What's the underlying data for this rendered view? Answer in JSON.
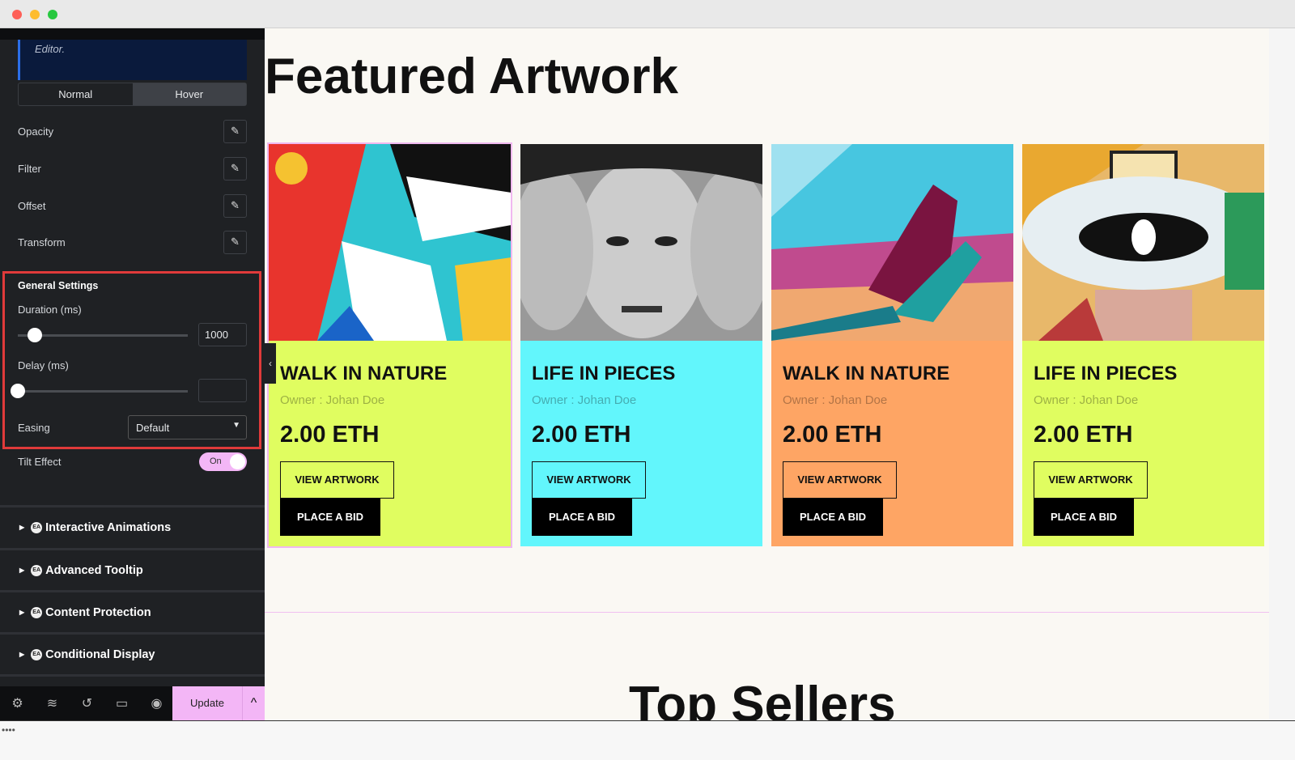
{
  "sidebar": {
    "notice": "Editor.",
    "tabs": [
      "Normal",
      "Hover"
    ],
    "rows": [
      "Opacity",
      "Filter",
      "Offset",
      "Transform"
    ],
    "general_settings": "General Settings",
    "duration_label": "Duration (ms)",
    "duration_value": "1000",
    "delay_label": "Delay (ms)",
    "delay_value": "",
    "easing_label": "Easing",
    "easing_value": "Default",
    "tilt_label": "Tilt Effect",
    "tilt_value": "On",
    "sections": [
      "Interactive Animations",
      "Advanced Tooltip",
      "Content Protection",
      "Conditional Display"
    ],
    "update": "Update"
  },
  "canvas": {
    "heading": "Featured Artwork",
    "cards": [
      {
        "title": "WALK IN NATURE",
        "owner": "Owner : Johan Doe",
        "price": "2.00 ETH",
        "view": "VIEW ARTWORK",
        "bid": "PLACE A BID",
        "color": "#e0fd60"
      },
      {
        "title": "LIFE IN PIECES",
        "owner": "Owner : Johan Doe",
        "price": "2.00 ETH",
        "view": "VIEW ARTWORK",
        "bid": "PLACE A BID",
        "color": "#62f6fc"
      },
      {
        "title": "WALK IN NATURE",
        "owner": "Owner : Johan Doe",
        "price": "2.00 ETH",
        "view": "VIEW ARTWORK",
        "bid": "PLACE A BID",
        "color": "#fea564"
      },
      {
        "title": "LIFE IN PIECES",
        "owner": "Owner : Johan Doe",
        "price": "2.00 ETH",
        "view": "VIEW ARTWORK",
        "bid": "PLACE A BID",
        "color": "#e0fd60"
      }
    ],
    "heading2": "Top Sellers"
  }
}
